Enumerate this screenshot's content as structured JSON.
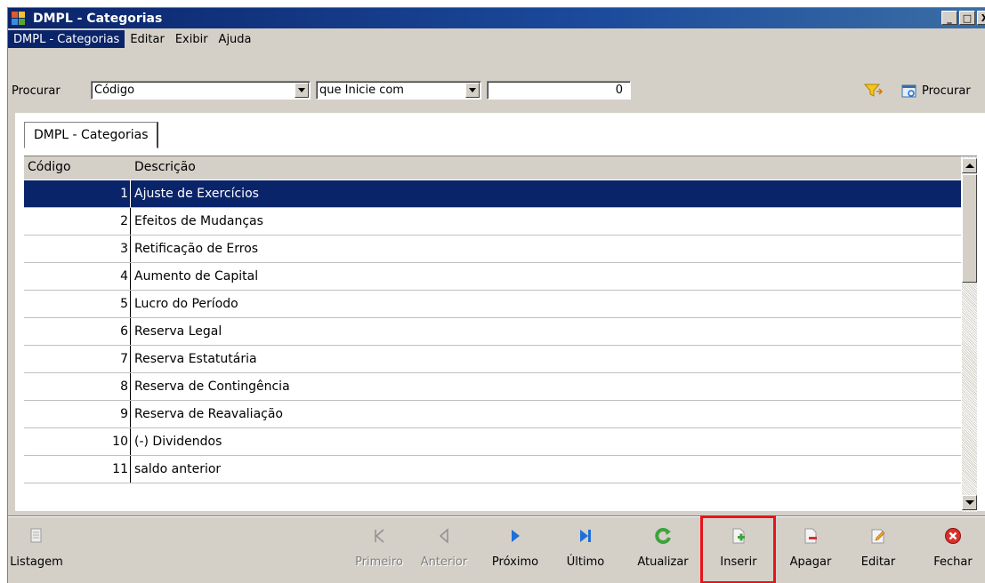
{
  "window": {
    "title": "DMPL - Categorias",
    "controls": [
      "_",
      "□",
      "X"
    ]
  },
  "menu": [
    {
      "label": "DMPL - Categorias",
      "active": true
    },
    {
      "label": "Editar"
    },
    {
      "label": "Exibir"
    },
    {
      "label": "Ajuda"
    }
  ],
  "search": {
    "label": "Procurar",
    "field": "Código",
    "mode": "que Inicie com",
    "value": "0",
    "button": "Procurar"
  },
  "tab": {
    "label": "DMPL - Categorias"
  },
  "grid": {
    "columns": [
      "Código",
      "Descrição"
    ],
    "rows": [
      {
        "code": "1",
        "desc": "Ajuste de Exercícios",
        "selected": true
      },
      {
        "code": "2",
        "desc": "Efeitos de Mudanças"
      },
      {
        "code": "3",
        "desc": "Retificação de Erros"
      },
      {
        "code": "4",
        "desc": "Aumento de Capital"
      },
      {
        "code": "5",
        "desc": "Lucro do Período"
      },
      {
        "code": "6",
        "desc": "Reserva Legal"
      },
      {
        "code": "7",
        "desc": "Reserva Estatutária"
      },
      {
        "code": "8",
        "desc": "Reserva de Contingência"
      },
      {
        "code": "9",
        "desc": "Reserva de Reavaliação"
      },
      {
        "code": "10",
        "desc": "(-) Dividendos"
      },
      {
        "code": "11",
        "desc": "saldo anterior"
      }
    ]
  },
  "toolbar": {
    "listagem": "Listagem",
    "primeiro": "Primeiro",
    "anterior": "Anterior",
    "proximo": "Próximo",
    "ultimo": "Último",
    "atualizar": "Atualizar",
    "inserir": "Inserir",
    "apagar": "Apagar",
    "editar": "Editar",
    "fechar": "Fechar"
  },
  "colors": {
    "selection": "#0a246a",
    "highlight": "#e8131a",
    "nav_blue": "#1f6fd6",
    "refresh_green": "#3da33d",
    "close_red": "#d9302a"
  }
}
